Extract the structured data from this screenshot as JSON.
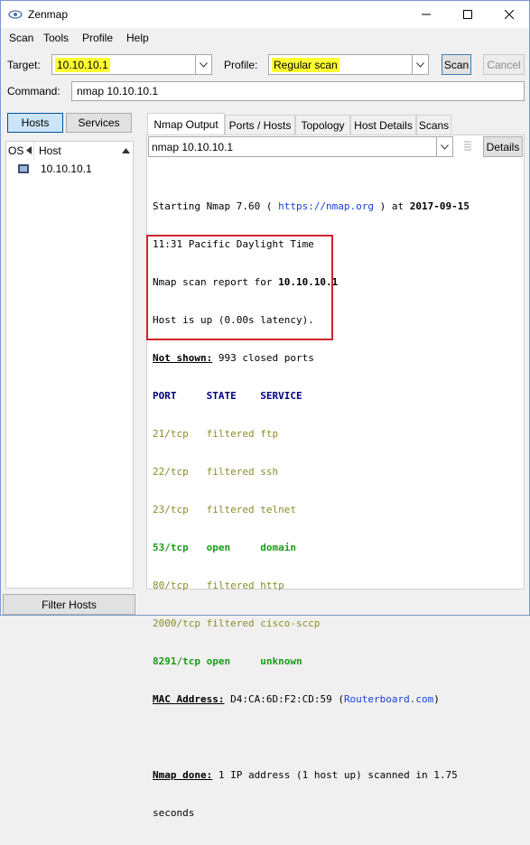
{
  "window": {
    "title": "Zenmap"
  },
  "menu": [
    "Scan",
    "Tools",
    "Profile",
    "Help"
  ],
  "target": {
    "label": "Target:",
    "value": "10.10.10.1"
  },
  "profile": {
    "label": "Profile:",
    "value": "Regular scan"
  },
  "buttons": {
    "scan": "Scan",
    "cancel": "Cancel",
    "details": "Details",
    "filter_hosts": "Filter Hosts"
  },
  "command": {
    "label": "Command:",
    "value": "nmap 10.10.10.1"
  },
  "left_tabs": [
    "Hosts",
    "Services"
  ],
  "host_list": {
    "col_os": "OS",
    "col_host": "Host",
    "hosts": [
      "10.10.10.1"
    ]
  },
  "tabs": [
    "Nmap Output",
    "Ports / Hosts",
    "Topology",
    "Host Details",
    "Scans"
  ],
  "output_selector": "nmap 10.10.10.1",
  "output": {
    "l1a": "Starting Nmap 7.60 ( ",
    "l1link": "https://nmap.org",
    "l1b": " ) at ",
    "l1date": "2017-09-15",
    "l2": "11:31 Pacific Daylight Time",
    "l3a": "Nmap scan report for ",
    "l3ip": "10.10.10.1",
    "l4": "Host is up (0.00s latency).",
    "l5a": "Not shown:",
    "l5b": " 993 closed ports",
    "ports_header": "PORT     STATE    SERVICE",
    "ports": [
      {
        "text": "21/tcp   filtered ftp",
        "state": "filtered"
      },
      {
        "text": "22/tcp   filtered ssh",
        "state": "filtered"
      },
      {
        "text": "23/tcp   filtered telnet",
        "state": "filtered"
      },
      {
        "text": "53/tcp   open     domain",
        "state": "open"
      },
      {
        "text": "80/tcp   filtered http",
        "state": "filtered"
      },
      {
        "text": "2000/tcp filtered cisco-sccp",
        "state": "filtered"
      },
      {
        "text": "8291/tcp open     unknown",
        "state": "open"
      }
    ],
    "mac_label": "MAC Address:",
    "mac_value": " D4:CA:6D:F2:CD:59 (",
    "mac_vendor": "Routerboard.com",
    "mac_close": ")",
    "done_label": "Nmap done:",
    "done_text": " 1 IP address (1 host up) scanned in 1.75",
    "done_text2": "seconds"
  },
  "colors": {
    "highlight": "#ffff33",
    "link": "#1a3fd8",
    "header": "#000080",
    "filtered": "#8c8c26",
    "open": "#1a9c1a",
    "box": "#d0232a"
  }
}
